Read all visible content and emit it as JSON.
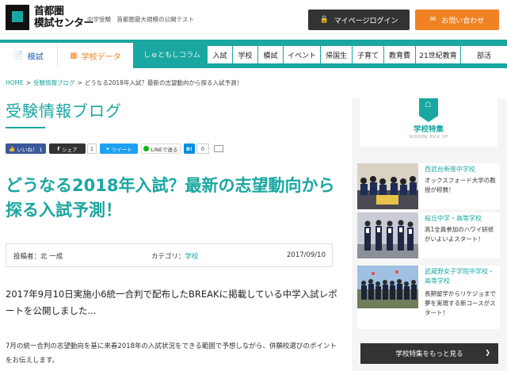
{
  "header": {
    "logo_line1": "首都圏",
    "logo_line2": "模試センター",
    "tagline": "中学受験　首都圏最大規模の公開テスト",
    "login_label": "マイページログイン",
    "contact_label": "お問い合わせ"
  },
  "nav": {
    "tab_moshi": "模試",
    "tab_school_data": "学校データ",
    "tab_column": "しゅともしコラム",
    "menu": [
      "入試",
      "学校",
      "模試",
      "イベント",
      "帰国生",
      "子育て",
      "教育費",
      "21世紀教育",
      "部活"
    ]
  },
  "breadcrumb": {
    "home": "HOME",
    "blog": "受験情報ブログ",
    "current": "どうなる2018年入試？最新の志望動向から探る入試予測！",
    "separator": ">"
  },
  "blog_title": "受験情報ブログ",
  "share": {
    "like": "いいね！ 1",
    "fb_share": "シェア",
    "fb_count": "1",
    "tweet": "ツイート",
    "line": "LINEで送る",
    "hatena": "B!",
    "hatena_count": "0"
  },
  "article": {
    "title": "どうなる2018年入試？最新の志望動向から探る入試予測！",
    "author": "投稿者：北 一成",
    "category_label": "カテゴリ：",
    "category": "学校",
    "date": "2017/09/10",
    "lead": "2017年9月10日実施小6統一合判で配布したBREAKに掲載している中学入試レポートを公開しました...",
    "body": "7月の統一合判の志望動向を基に来春2018年の入試状況をできる範囲で予想しながら、併願校選びのポイントをお伝えします。"
  },
  "sidebar": {
    "title": "学校特集",
    "subtitle": "SCHOOL PICK UP",
    "cards": [
      {
        "title": "西武台新座中学校",
        "desc": "オックスフォード大学の教授が称賛！"
      },
      {
        "title": "桜丘中学・高等学校",
        "desc": "高1全員参加のハワイ研修がいよいよスタート！"
      },
      {
        "title": "武蔵野女子学院中学校・高等学校",
        "desc": "長期留学からリケジョまで 夢を実現する新コースがスタート！"
      }
    ],
    "more_label": "学校特集をもっと見る"
  },
  "colors": {
    "teal": "#1aa7a1",
    "orange": "#f08223",
    "dark": "#333333",
    "link_blue": "#2a5db0",
    "facebook": "#3b5998",
    "twitter": "#1da1f2",
    "line": "#00b900",
    "hatena": "#008fde"
  }
}
